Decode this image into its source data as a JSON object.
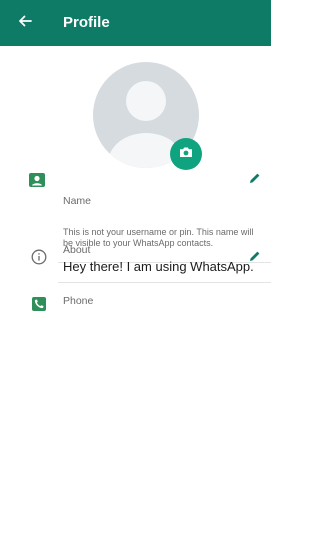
{
  "appbar": {
    "title": "Profile"
  },
  "profile": {
    "name_label": "Name",
    "name_hint": "This is not your username or pin. This name will be visible to your WhatsApp contacts.",
    "about_label": "About",
    "about_value": "Hey there! I am using WhatsApp.",
    "phone_label": "Phone"
  },
  "icons": {
    "back": "arrow-left-icon",
    "camera": "camera-icon",
    "name": "person-icon",
    "about": "info-icon",
    "phone": "phone-icon",
    "edit": "pencil-icon"
  },
  "colors": {
    "appbar": "#0e7b66",
    "accent": "#10a37f"
  }
}
